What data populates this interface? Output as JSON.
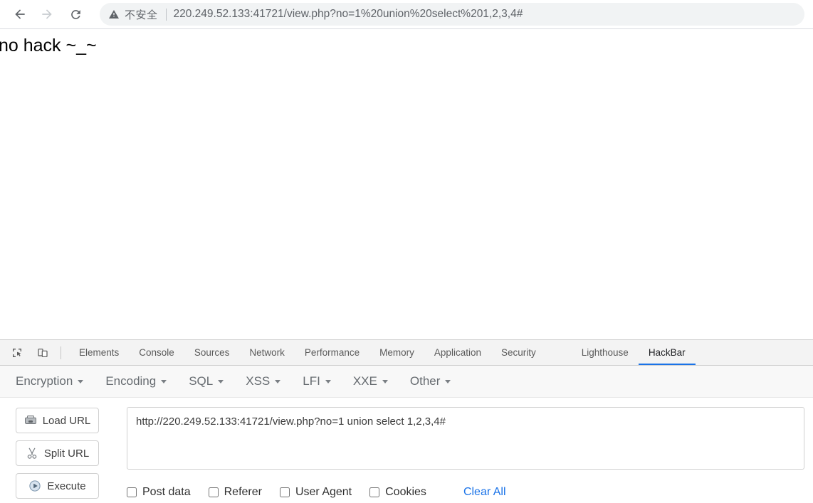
{
  "browser": {
    "back_icon": "arrow-left-icon",
    "forward_icon": "arrow-right-icon",
    "reload_icon": "reload-icon",
    "security_warning_icon": "warning-triangle-icon",
    "security_label": "不安全",
    "url": "220.249.52.133:41721/view.php?no=1%20union%20select%201,2,3,4#"
  },
  "page": {
    "body_text": "no hack ~_~"
  },
  "devtools": {
    "inspect_icon": "inspect-element-icon",
    "device_toolbar_icon": "device-toolbar-icon",
    "tabs": [
      {
        "label": "Elements",
        "active": false
      },
      {
        "label": "Console",
        "active": false
      },
      {
        "label": "Sources",
        "active": false
      },
      {
        "label": "Network",
        "active": false
      },
      {
        "label": "Performance",
        "active": false
      },
      {
        "label": "Memory",
        "active": false
      },
      {
        "label": "Application",
        "active": false
      },
      {
        "label": "Security",
        "active": false
      },
      {
        "label": "Lighthouse",
        "active": false
      },
      {
        "label": "HackBar",
        "active": true
      }
    ],
    "active_tab_accent": "#1a73e8"
  },
  "hackbar": {
    "menus": [
      {
        "label": "Encryption"
      },
      {
        "label": "Encoding"
      },
      {
        "label": "SQL"
      },
      {
        "label": "XSS"
      },
      {
        "label": "LFI"
      },
      {
        "label": "XXE"
      },
      {
        "label": "Other"
      }
    ],
    "buttons": [
      {
        "label": "Load URL",
        "icon": "load-url-icon"
      },
      {
        "label": "Split URL",
        "icon": "scissors-icon"
      },
      {
        "label": "Execute",
        "icon": "play-circle-icon"
      }
    ],
    "url_field": {
      "value": "http://220.249.52.133:41721/view.php?no=1 union select 1,2,3,4#",
      "placeholder": ""
    },
    "options": [
      {
        "label": "Post data",
        "checked": false
      },
      {
        "label": "Referer",
        "checked": false
      },
      {
        "label": "User Agent",
        "checked": false
      },
      {
        "label": "Cookies",
        "checked": false
      }
    ],
    "clear_all_label": "Clear All",
    "clear_all_color": "#1a73e8"
  }
}
